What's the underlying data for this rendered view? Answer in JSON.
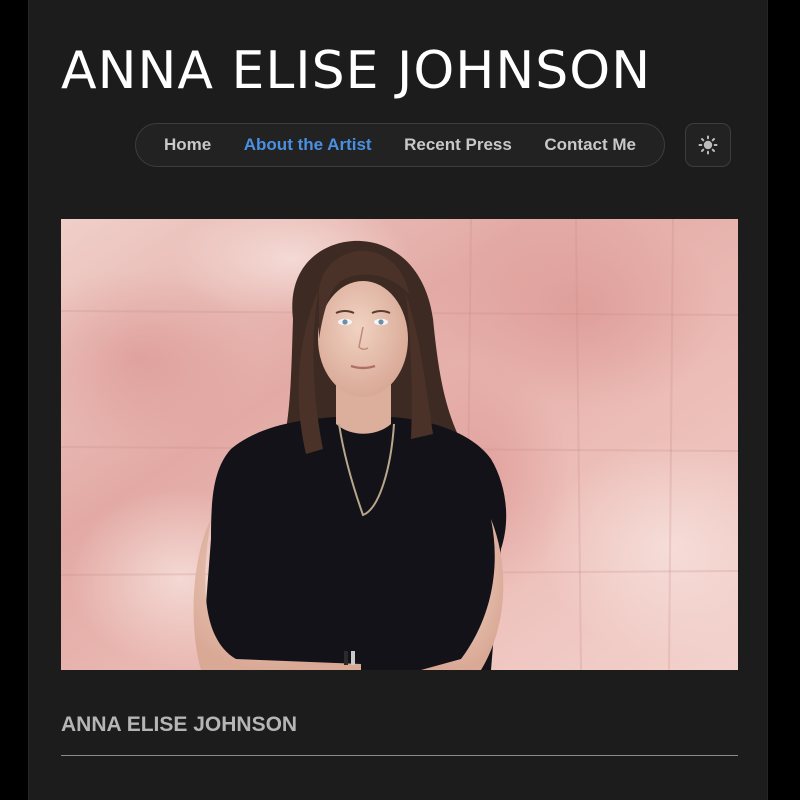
{
  "site": {
    "title": "ANNA ELISE JOHNSON"
  },
  "nav": {
    "items": [
      {
        "label": "Home",
        "active": false
      },
      {
        "label": "About the Artist",
        "active": true
      },
      {
        "label": "Recent Press",
        "active": false
      },
      {
        "label": "Contact Me",
        "active": false
      }
    ]
  },
  "theme_toggle": {
    "icon": "sun-icon"
  },
  "hero": {
    "image": "portrait-photo"
  },
  "content": {
    "heading": "ANNA ELISE JOHNSON"
  },
  "colors": {
    "page_background": "#1c1c1c",
    "outer_background": "#000000",
    "active_link": "#4a90e2",
    "nav_text": "#c8c8c8",
    "heading_text": "#b5b5b5"
  }
}
